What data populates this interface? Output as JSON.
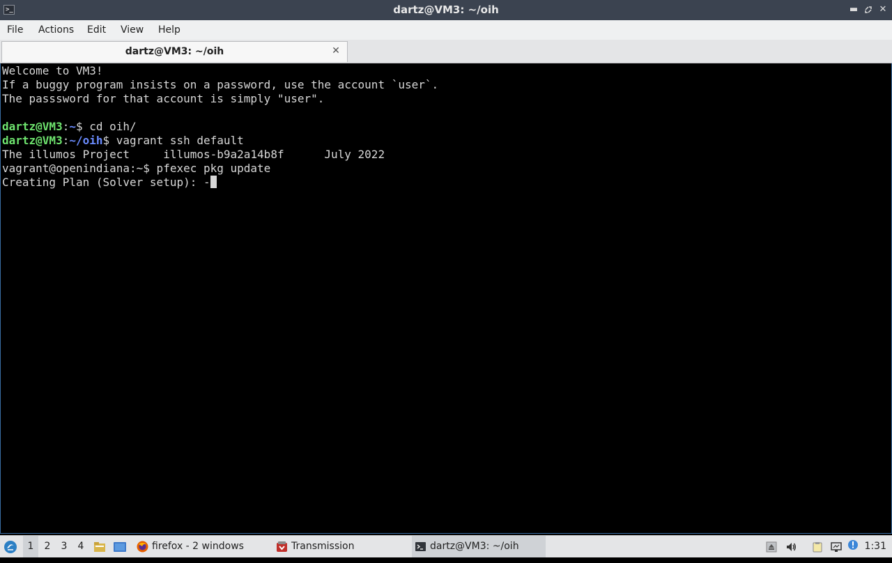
{
  "window": {
    "title": "dartz@VM3: ~/oih",
    "icons": [
      "terminal-icon",
      "minimize-icon",
      "maximize-icon",
      "close-icon"
    ]
  },
  "menubar": {
    "items": [
      "File",
      "Actions",
      "Edit",
      "View",
      "Help"
    ]
  },
  "tabs": [
    {
      "label": "dartz@VM3: ~/oih"
    }
  ],
  "terminal": {
    "lines": [
      "Welcome to VM3!",
      "If a buggy program insists on a password, use the account `user`.",
      "The passsword for that account is simply \"user\"."
    ],
    "prompt1": {
      "user": "dartz@VM3",
      "colon": ":",
      "path": "~",
      "command": "$ cd oih/"
    },
    "prompt2": {
      "user": "dartz@VM3",
      "colon": ":",
      "path": "~/oih",
      "command": "$ vagrant ssh default"
    },
    "illumos_line": "The illumos Project     illumos-b9a2a14b8f      July 2022",
    "remote_prompt": "vagrant@openindiana:~$ pfexec pkg update",
    "status_line": "Creating Plan (Solver setup): -"
  },
  "taskbar": {
    "desktops": [
      "1",
      "2",
      "3",
      "4"
    ],
    "active_desktop": "1",
    "tasks": [
      {
        "label": "firefox - 2 windows",
        "icon": "firefox-icon"
      },
      {
        "label": "Transmission",
        "icon": "transmission-icon"
      },
      {
        "label": "dartz@VM3: ~/oih",
        "icon": "terminal-icon"
      }
    ],
    "clock": "1:31",
    "tray": [
      "eject-icon",
      "volume-icon",
      "clipboard-icon",
      "network-icon",
      "update-notifier-icon"
    ]
  },
  "colors": {
    "titlebar": "#3b4350",
    "prompt_user": "#6ee36e",
    "prompt_path": "#6b8cff",
    "terminal_bg": "#000000",
    "terminal_fg": "#d8d8d8"
  }
}
